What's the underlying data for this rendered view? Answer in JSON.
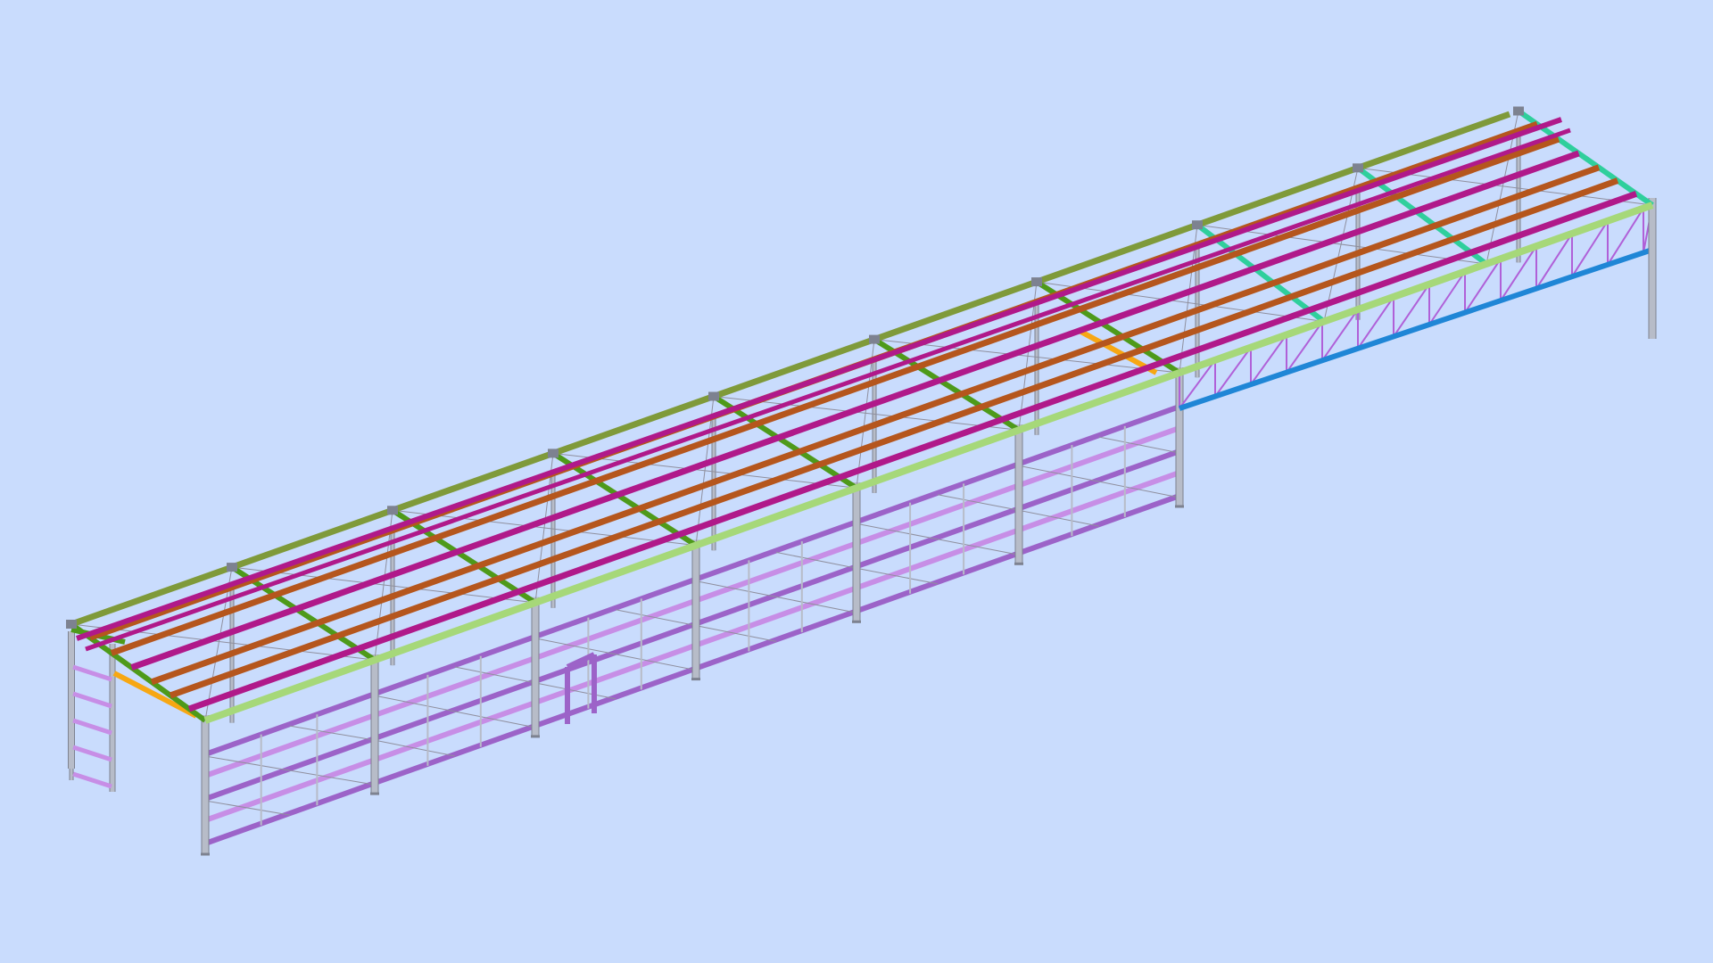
{
  "viewport": {
    "background": "#c9dcfd",
    "view": "isometric",
    "subject": "steel-frame-structure"
  },
  "member_colors": {
    "column": "#b7bcc8",
    "column_edge": "#7d8290",
    "wall_girt": "#c78ee6",
    "wall_girt_dark": "#9c63c8",
    "eave_beam": "#a6d879",
    "ridge_beam": "#7f9a3a",
    "roof_purlin_brown": "#b5561d",
    "roof_purlin_magenta": "#b0198a",
    "rafter": "#4e9a1a",
    "rafter_end": "#2fcf9c",
    "roof_truss": "#b060d8",
    "canopy_tie": "#1f86d6",
    "gable_strut": "#f7a713",
    "bracing": "#8f8f9e"
  }
}
